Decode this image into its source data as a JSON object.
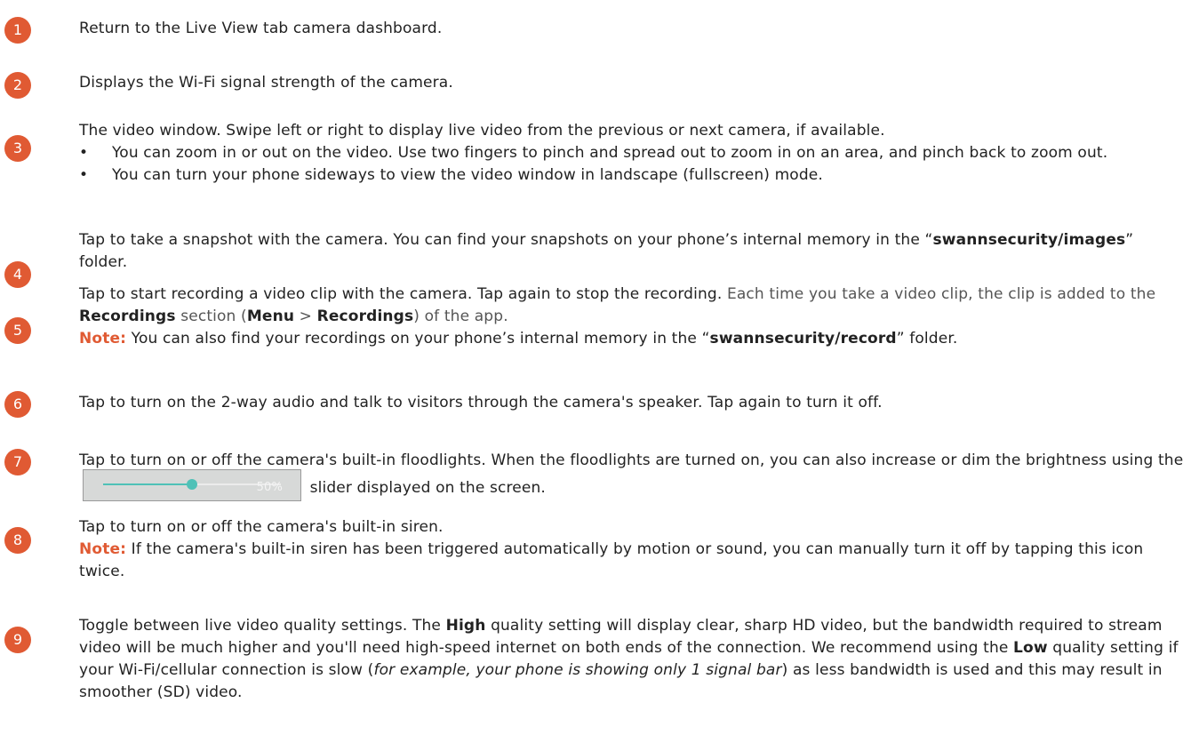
{
  "items": [
    {
      "num": "1",
      "text": "Return to the Live View tab camera dashboard."
    },
    {
      "num": "2",
      "text": "Displays the Wi-Fi signal strength of the camera."
    },
    {
      "num": "3",
      "text": "The video window. Swipe left or right to display live video from the previous or next camera, if available.",
      "bullets": [
        "You can zoom in or out on the video. Use two fingers to pinch and spread out to zoom in on an area, and pinch back to zoom out.",
        "You can turn your phone sideways to view the video window in landscape (fullscreen) mode."
      ]
    },
    {
      "num": "4",
      "a": "Tap to take a snapshot with the camera. You can find your snapshots on your phone’s internal memory in the “",
      "b": "swannsecurity/images",
      "c": "” folder."
    },
    {
      "num": "5",
      "a": "Tap to start recording a video clip with the camera. Tap again to stop the recording. ",
      "b": "Each time you take a video clip, the clip is added to the ",
      "c": "Recordings",
      "d": " section (",
      "e": "Menu",
      "f": " > ",
      "g": "Recordings",
      "h": ") of the app.",
      "note_label": "Note:",
      "note_a": " You can also find your recordings on your phone’s internal memory in the “",
      "note_b": "swannsecurity/record",
      "note_c": "” folder."
    },
    {
      "num": "6",
      "text": "Tap to turn on the 2-way audio and talk to visitors through the camera's speaker. Tap again to turn it off."
    },
    {
      "num": "7",
      "a": "Tap to turn on or off the camera's built-in floodlights. When the floodlights are turned on, you can also increase or dim the brightness using the",
      "slider_value": 0.5,
      "slider_label": "50%",
      "b": "slider displayed on the screen."
    },
    {
      "num": "8",
      "text": "Tap to turn on or off the camera's built-in siren.",
      "note_label": "Note:",
      "note_text": " If the camera's built-in siren has been triggered automatically by motion or sound, you can manually turn it off by tapping this icon twice."
    },
    {
      "num": "9",
      "a": "Toggle between live video quality settings. The ",
      "b": "High",
      "c": " quality setting will display clear, sharp HD video, but the bandwidth required to stream video will be much higher and you'll need high-speed internet on both ends of the connection. We recommend using the ",
      "d": "Low",
      "e": " quality setting if your Wi-Fi/cellular connection is slow (",
      "f": "for example, your phone is showing only 1 signal bar",
      "g": ") as less bandwidth is used and this may result in smoother (SD) video."
    }
  ],
  "bullet_char": "•"
}
